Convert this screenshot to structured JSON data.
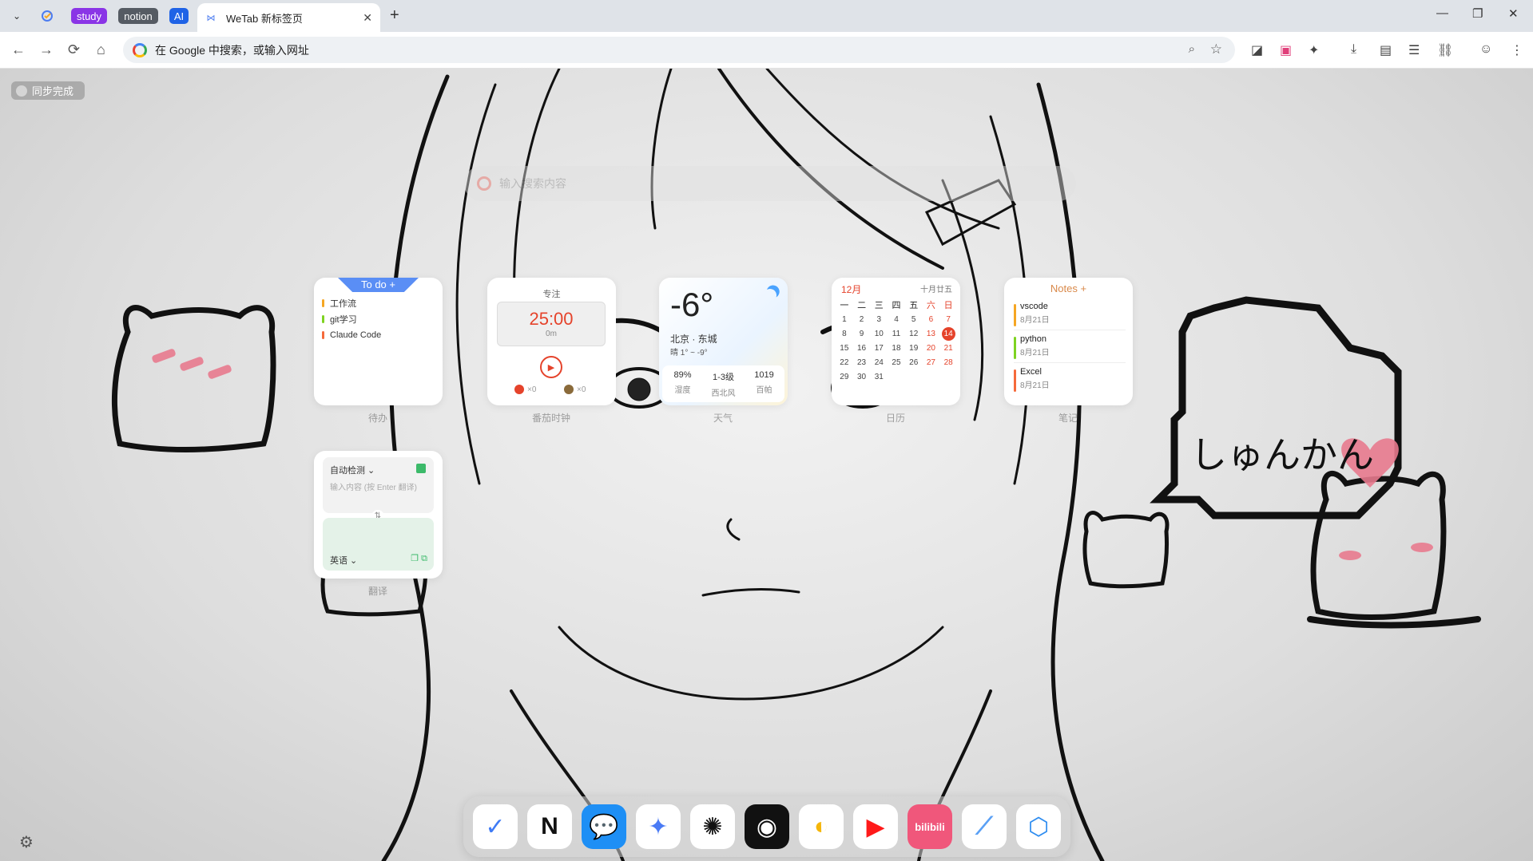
{
  "tabstrip": {
    "tab_menu_icon": "chevron-down-icon",
    "pinned": [
      {
        "label": "",
        "icon": "ticktick-icon"
      },
      {
        "label": "study",
        "color": "#8a35e6"
      },
      {
        "label": "notion",
        "color": "#555b63"
      },
      {
        "label": "AI",
        "color": "#1f63e6"
      }
    ],
    "active_tab": {
      "title": "WeTab 新标签页",
      "close": "✕"
    },
    "new_tab": "+",
    "window_controls": [
      "—",
      "❐",
      "✕"
    ]
  },
  "toolbar": {
    "back": "←",
    "forward": "→",
    "reload": "⟳",
    "home": "⌂",
    "omnibox_placeholder": "在 Google 中搜索，或输入网址",
    "zoom_icon": "⌕",
    "star_icon": "☆",
    "extensions": [
      "◪",
      "▣",
      "✦",
      "⤓",
      "▤",
      "☰",
      "⛓",
      "☺",
      "⋮"
    ]
  },
  "page": {
    "sync_status": "同步完成",
    "search_placeholder": "输入搜索内容",
    "todo": {
      "header": "To do +",
      "items": [
        {
          "text": "工作流",
          "color": "#f5a623"
        },
        {
          "text": "git学习",
          "color": "#7ed321"
        },
        {
          "text": "Claude Code",
          "color": "#f56a3b"
        }
      ],
      "label": "待办"
    },
    "focus": {
      "title": "专注",
      "time": "25:00",
      "minutes": "0m",
      "tomato_count": "×0",
      "done_count": "×0",
      "label": "番茄时钟"
    },
    "weather": {
      "temp": "-6°",
      "city": "北京 · 东城",
      "range": "晴 1° ~ -9°",
      "stats": [
        {
          "value": "89%",
          "label": "湿度"
        },
        {
          "value": "1-3级",
          "label": "西北风"
        },
        {
          "value": "1019",
          "label": "百帕"
        }
      ],
      "label": "天气"
    },
    "calendar": {
      "month": "12月",
      "lunar": "十月廿五",
      "weekdays": [
        "一",
        "二",
        "三",
        "四",
        "五",
        "六",
        "日"
      ],
      "days": [
        1,
        2,
        3,
        4,
        5,
        6,
        7,
        8,
        9,
        10,
        11,
        12,
        13,
        14,
        15,
        16,
        17,
        18,
        19,
        20,
        21,
        22,
        23,
        24,
        25,
        26,
        27,
        28,
        29,
        30,
        31
      ],
      "today": 14,
      "label": "日历"
    },
    "notes": {
      "header": "Notes +",
      "items": [
        {
          "name": "vscode",
          "date": "8月21日",
          "color": "#f5a623"
        },
        {
          "name": "python",
          "date": "8月21日",
          "color": "#7ed321"
        },
        {
          "name": "Excel",
          "date": "8月21日",
          "color": "#f56a3b"
        }
      ],
      "label": "笔记"
    },
    "translate": {
      "source_lang": "自动检测 ⌄",
      "placeholder": "输入内容 (按 Enter 翻译)",
      "target_lang": "英语 ⌄",
      "swap": "⇅",
      "label": "翻译"
    },
    "artwork_text": "しゅんかん",
    "dock": [
      {
        "name": "ticktick",
        "glyph": "✓",
        "bg": "#ffffff",
        "fg": "#3f7bf5"
      },
      {
        "name": "notion",
        "glyph": "N",
        "bg": "#ffffff",
        "fg": "#111111"
      },
      {
        "name": "messages",
        "glyph": "💬",
        "bg": "#1e8ff5",
        "fg": "#ffffff"
      },
      {
        "name": "gemini",
        "glyph": "✦",
        "bg": "#ffffff",
        "fg": "#4a7bf5"
      },
      {
        "name": "chatgpt",
        "glyph": "✺",
        "bg": "#ffffff",
        "fg": "#111111"
      },
      {
        "name": "github",
        "glyph": "◉",
        "bg": "#111111",
        "fg": "#ffffff"
      },
      {
        "name": "notes-app",
        "glyph": "◐",
        "bg": "#ffffff",
        "fg": "#f5b60a"
      },
      {
        "name": "youtube",
        "glyph": "▶",
        "bg": "#ffffff",
        "fg": "#ff1a1a"
      },
      {
        "name": "bilibili",
        "glyph": "bilibili",
        "bg": "#f0577b",
        "fg": "#ffffff"
      },
      {
        "name": "browser",
        "glyph": "⟋",
        "bg": "#ffffff",
        "fg": "#5aa0f5"
      },
      {
        "name": "box",
        "glyph": "⬡",
        "bg": "#ffffff",
        "fg": "#2d8cf0"
      }
    ],
    "settings_icon": "⚙"
  }
}
